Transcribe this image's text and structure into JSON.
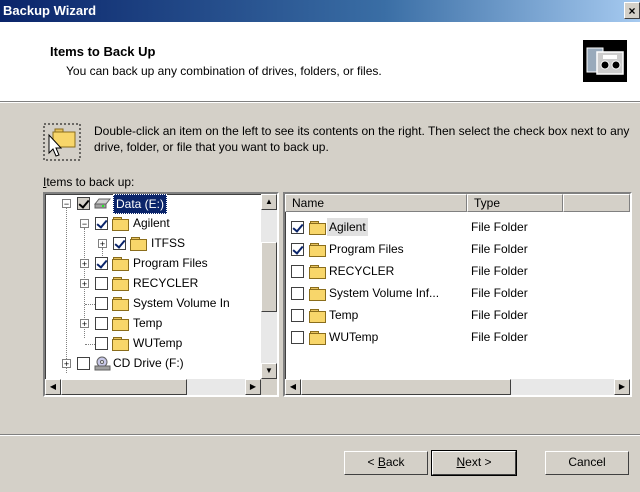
{
  "window": {
    "title": "Backup Wizard",
    "close_glyph": "×"
  },
  "header": {
    "title": "Items to Back Up",
    "subtitle": "You can back up any combination of drives, folders, or files.",
    "icon": "backup-wizard-icon"
  },
  "instructions": "Double-click an item on the left to see its contents on the right. Then select the check box next to any drive, folder, or file that you want to back up.",
  "items_label_prefix": "I",
  "items_label_rest": "tems to back up:",
  "tree": [
    {
      "label": "Data (E:)",
      "type": "drive",
      "checked": true
    },
    {
      "label": "Agilent",
      "type": "folder",
      "checked": true
    },
    {
      "label": "ITFSS",
      "type": "folder",
      "checked": true
    },
    {
      "label": "Program Files",
      "type": "folder",
      "checked": true
    },
    {
      "label": "RECYCLER",
      "type": "folder",
      "checked": false
    },
    {
      "label": "System Volume In",
      "type": "folder",
      "checked": false
    },
    {
      "label": "Temp",
      "type": "folder",
      "checked": false
    },
    {
      "label": "WUTemp",
      "type": "folder",
      "checked": false
    },
    {
      "label": "CD Drive (F:)",
      "type": "cdrom",
      "checked": false
    }
  ],
  "list": {
    "columns": [
      "Name",
      "Type"
    ],
    "rows": [
      {
        "name": "Agilent",
        "type": "File Folder",
        "checked": true
      },
      {
        "name": "Program Files",
        "type": "File Folder",
        "checked": true
      },
      {
        "name": "RECYCLER",
        "type": "File Folder",
        "checked": false
      },
      {
        "name": "System Volume Inf...",
        "type": "File Folder",
        "checked": false
      },
      {
        "name": "Temp",
        "type": "File Folder",
        "checked": false
      },
      {
        "name": "WUTemp",
        "type": "File Folder",
        "checked": false
      }
    ]
  },
  "buttons": {
    "back_prefix": "< ",
    "back_u": "B",
    "back_rest": "ack",
    "next_u": "N",
    "next_rest": "ext >",
    "cancel": "Cancel"
  }
}
